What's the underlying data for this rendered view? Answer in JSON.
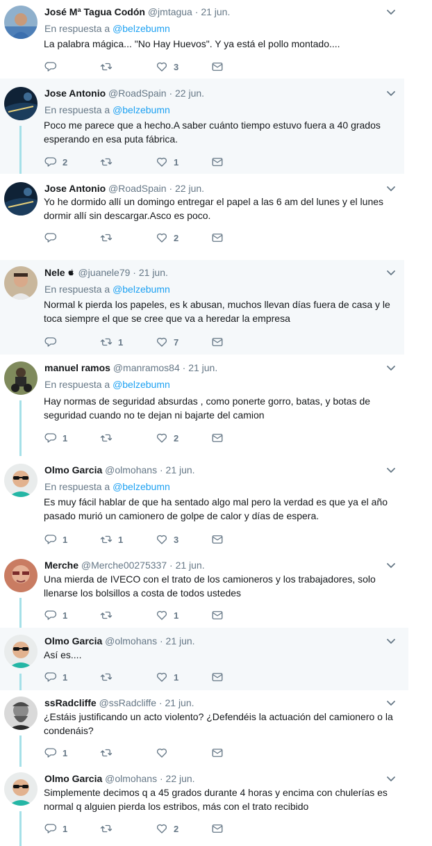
{
  "reply_prefix": "En respuesta a",
  "colors": {
    "thread": "#a5e0e8",
    "link": "#1da1f2",
    "muted": "#657786",
    "shaded_bg": "#f5f8fa"
  },
  "icons": {
    "reply": "reply-icon",
    "retweet": "retweet-icon",
    "like": "heart-icon",
    "message": "envelope-icon",
    "menu": "chevron-down-icon"
  },
  "tweets": [
    {
      "name": "José Mª Tagua Codón",
      "handle": "@jmtagua",
      "sep": "·",
      "date": "21 jun.",
      "reply_to": "@belzebumn",
      "lines": [
        "La palabra mágica... \"No Hay Huevos\". Y ya está el pollo montado...."
      ],
      "replies": "",
      "retweets": "",
      "likes": "3"
    },
    {
      "name": "Jose Antonio",
      "handle": "@RoadSpain",
      "sep": "·",
      "date": "22 jun.",
      "reply_to": "@belzebumn",
      "lines": [
        "Poco me parece que a hecho.A saber cuánto tiempo estuvo fuera a 40 grados",
        "esperando en esa puta fábrica."
      ],
      "replies": "2",
      "retweets": "",
      "likes": "1"
    },
    {
      "name": "Jose Antonio",
      "handle": "@RoadSpain",
      "sep": "·",
      "date": "22 jun.",
      "reply_to": "",
      "lines": [
        "Yo he dormido allí un domingo entregar el papel a las 6 am del lunes y el lunes",
        "dormir allí sin descargar.Asco es poco."
      ],
      "replies": "",
      "retweets": "",
      "likes": "2"
    },
    {
      "name": "Nele ",
      "handle": "@juanele79",
      "sep": "·",
      "date": "21 jun.",
      "reply_to": "@belzebumn",
      "lines": [
        "Normal k pierda los papeles, es k abusan, muchos llevan días fuera de casa y le",
        "toca siempre el que se cree que va a heredar la empresa"
      ],
      "replies": "",
      "retweets": "1",
      "likes": "7"
    },
    {
      "name": "manuel ramos",
      "handle": "@manramos84",
      "sep": "·",
      "date": "21 jun.",
      "reply_to": "@belzebumn",
      "lines": [
        "Hay normas de seguridad absurdas , como ponerte gorro, batas, y botas de",
        "seguridad cuando no te dejan ni bajarte del camion"
      ],
      "replies": "1",
      "retweets": "",
      "likes": "2"
    },
    {
      "name": "Olmo Garcia",
      "handle": "@olmohans",
      "sep": "·",
      "date": "21 jun.",
      "reply_to": "@belzebumn",
      "lines": [
        "Es muy fácil hablar de que ha sentado algo mal pero la verdad es que ya el año",
        "pasado murió un camionero de golpe de calor y días de espera."
      ],
      "replies": "1",
      "retweets": "1",
      "likes": "3"
    },
    {
      "name": "Merche",
      "handle": "@Merche00275337",
      "sep": "·",
      "date": "21 jun.",
      "reply_to": "",
      "lines": [
        "Una mierda de IVECO con el trato de los camioneros y los trabajadores, solo",
        "llenarse los bolsillos a costa de todos ustedes"
      ],
      "replies": "1",
      "retweets": "",
      "likes": "1"
    },
    {
      "name": "Olmo Garcia",
      "handle": "@olmohans",
      "sep": "·",
      "date": "21 jun.",
      "reply_to": "",
      "lines": [
        "Así es...."
      ],
      "replies": "1",
      "retweets": "",
      "likes": "1"
    },
    {
      "name": "ssRadcliffe",
      "handle": "@ssRadcliffe",
      "sep": "·",
      "date": "21 jun.",
      "reply_to": "",
      "lines": [
        "¿Estáis justificando un acto violento? ¿Defendéis la actuación del camionero o la",
        "condenáis?"
      ],
      "replies": "1",
      "retweets": "",
      "likes": ""
    },
    {
      "name": "Olmo Garcia",
      "handle": "@olmohans",
      "sep": "·",
      "date": "22 jun.",
      "reply_to": "",
      "lines": [
        "Simplemente decimos q a 45 grados durante  4 horas y encima con chulerías es",
        "normal q alguien pierda los estribos, más con el trato recibido"
      ],
      "replies": "1",
      "retweets": "",
      "likes": "2"
    }
  ]
}
